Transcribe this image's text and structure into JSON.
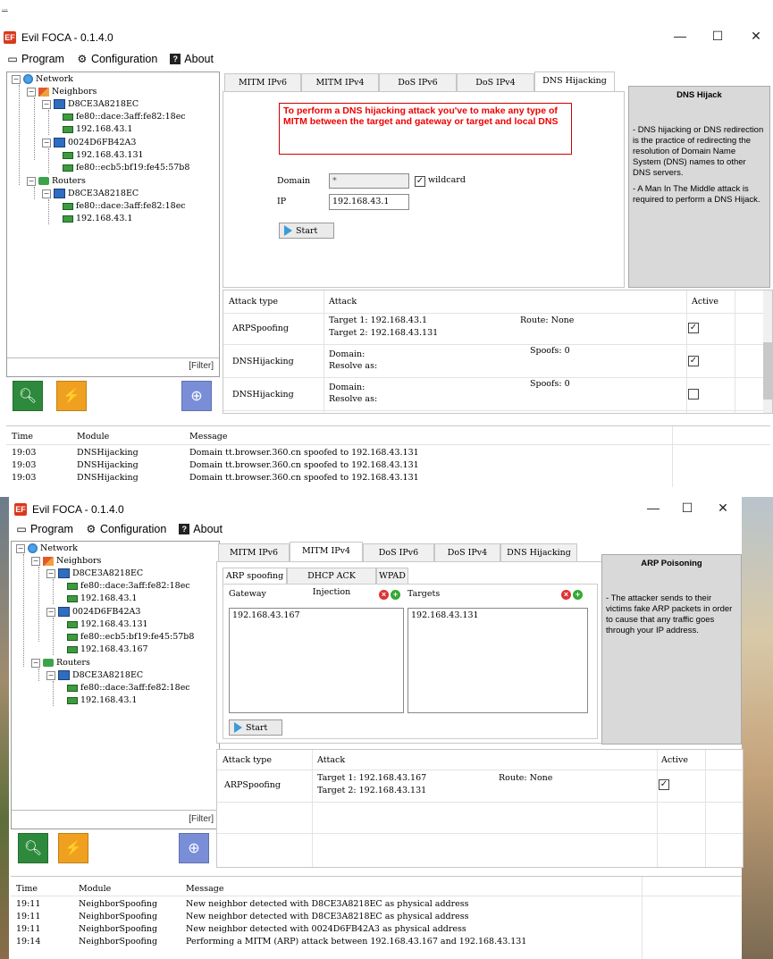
{
  "top_snippet": "...",
  "window1": {
    "title": "Evil FOCA - 0.1.4.0",
    "app_icon": "EF",
    "controls": {
      "minimize": "—",
      "maximize": "☐",
      "close": "✕"
    },
    "menu": {
      "program": "Program",
      "configuration": "Configuration",
      "about": "About"
    },
    "tree": {
      "network": "Network",
      "neighbors": "Neighbors",
      "n1": "D8CE3A8218EC",
      "n1_a": "fe80::dace:3aff:fe82:18ec",
      "n1_b": "192.168.43.1",
      "n2": "0024D6FB42A3",
      "n2_a": "192.168.43.131",
      "n2_b": "fe80::ecb5:bf19:fe45:57b8",
      "routers": "Routers",
      "r1": "D8CE3A8218EC",
      "r1_a": "fe80::dace:3aff:fe82:18ec",
      "r1_b": "192.168.43.1"
    },
    "filter": "[Filter]",
    "tabs": [
      "MITM IPv6",
      "MITM IPv4",
      "DoS IPv6",
      "DoS IPv4",
      "DNS Hijacking"
    ],
    "warning": "To perform a DNS hijacking attack you've to make any type of MITM between the target and gateway or target and local DNS",
    "domain_label": "Domain",
    "domain_value": "*",
    "wildcard_label": "wildcard",
    "ip_label": "IP",
    "ip_value": "192.168.43.1",
    "start": "Start",
    "info": {
      "title": "DNS Hijack",
      "p1": "- DNS hijacking or DNS redirection is the practice of redirecting the resolution of Domain Name System (DNS) names to other DNS servers.",
      "p2": "- A Man In The Middle attack is required to perform a DNS Hijack."
    },
    "attacks": {
      "headers": {
        "type": "Attack type",
        "attack": "Attack",
        "active": "Active"
      },
      "rows": [
        {
          "type": "ARPSpoofing",
          "l1": "Target 1: 192.168.43.1",
          "l2": "Target 2: 192.168.43.131",
          "extra": "Route: None"
        },
        {
          "type": "DNSHijacking",
          "l1": "Domain:",
          "l2": "Resolve as:",
          "extra": "Spoofs: 0"
        },
        {
          "type": "DNSHijacking",
          "l1": "Domain:",
          "l2": "Resolve as:",
          "extra": "Spoofs: 0"
        }
      ]
    },
    "log": {
      "headers": {
        "time": "Time",
        "module": "Module",
        "message": "Message"
      },
      "rows": [
        {
          "time": "19:03",
          "module": "DNSHijacking",
          "message": "Domain tt.browser.360.cn spoofed to 192.168.43.131"
        },
        {
          "time": "19:03",
          "module": "DNSHijacking",
          "message": "Domain tt.browser.360.cn spoofed to 192.168.43.131"
        },
        {
          "time": "19:03",
          "module": "DNSHijacking",
          "message": "Domain tt.browser.360.cn spoofed to 192.168.43.131"
        }
      ]
    }
  },
  "window2": {
    "title": "Evil FOCA - 0.1.4.0",
    "app_icon": "EF",
    "controls": {
      "minimize": "—",
      "maximize": "☐",
      "close": "✕"
    },
    "menu": {
      "program": "Program",
      "configuration": "Configuration",
      "about": "About"
    },
    "tree": {
      "network": "Network",
      "neighbors": "Neighbors",
      "n1": "D8CE3A8218EC",
      "n1_a": "fe80::dace:3aff:fe82:18ec",
      "n1_b": "192.168.43.1",
      "n2": "0024D6FB42A3",
      "n2_a": "192.168.43.131",
      "n2_b": "fe80::ecb5:bf19:fe45:57b8",
      "n2_c": "192.168.43.167",
      "routers": "Routers",
      "r1": "D8CE3A8218EC",
      "r1_a": "fe80::dace:3aff:fe82:18ec",
      "r1_b": "192.168.43.1"
    },
    "filter": "[Filter]",
    "tabs": [
      "MITM IPv6",
      "MITM IPv4",
      "DoS IPv6",
      "DoS IPv4",
      "DNS Hijacking"
    ],
    "subtabs": [
      "ARP spoofing",
      "DHCP ACK Injection",
      "WPAD"
    ],
    "gateway_label": "Gateway",
    "targets_label": "Targets",
    "gateway_value": "192.168.43.167",
    "targets_value": "192.168.43.131",
    "start": "Start",
    "info": {
      "title": "ARP Poisoning",
      "p1": "- The attacker sends to their victims fake ARP packets in order to cause that any traffic goes through your IP address."
    },
    "attacks": {
      "headers": {
        "type": "Attack type",
        "attack": "Attack",
        "active": "Active"
      },
      "rows": [
        {
          "type": "ARPSpoofing",
          "l1": "Target 1: 192.168.43.167",
          "l2": "Target 2: 192.168.43.131",
          "extra": "Route: None"
        }
      ]
    },
    "log": {
      "headers": {
        "time": "Time",
        "module": "Module",
        "message": "Message"
      },
      "rows": [
        {
          "time": "19:11",
          "module": "NeighborSpoofing",
          "message": "New neighbor detected with D8CE3A8218EC as physical address"
        },
        {
          "time": "19:11",
          "module": "NeighborSpoofing",
          "message": "New neighbor detected with D8CE3A8218EC as physical address"
        },
        {
          "time": "19:11",
          "module": "NeighborSpoofing",
          "message": "New neighbor detected with 0024D6FB42A3 as physical address"
        },
        {
          "time": "19:14",
          "module": "NeighborSpoofing",
          "message": "Performing a MITM (ARP) attack between 192.168.43.167 and 192.168.43.131"
        }
      ]
    }
  }
}
